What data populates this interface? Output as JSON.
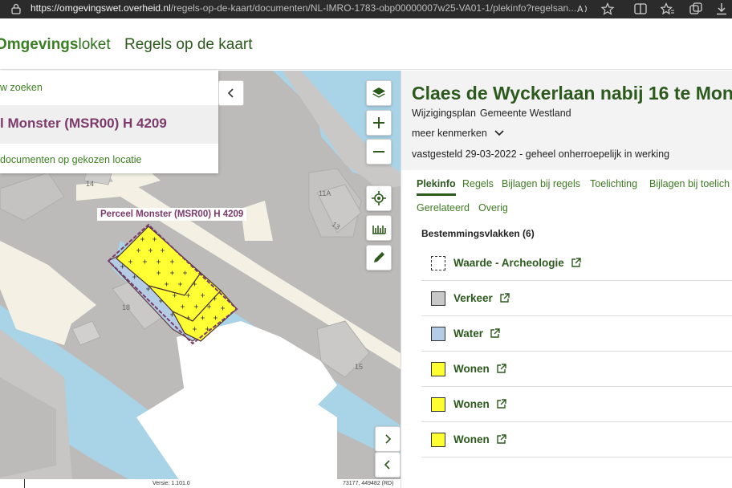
{
  "browser": {
    "url_host": "https://omgevingswet.overheid.nl",
    "url_path": "/regels-op-de-kaart/documenten/NL-IMRO-1783-obp00000007w25-VA01-1/plekinfo?regelsan..."
  },
  "header": {
    "brand_part1": "Omgevings",
    "brand_part2": "loket",
    "nav_title": "Regels op de kaart"
  },
  "search_panel": {
    "new_search": "w zoeken",
    "selected_location": "l Monster (MSR00) H 4209",
    "documents_link": "documenten op gekozen locatie"
  },
  "map": {
    "parcel_label": "Perceel Monster (MSR00) H 4209",
    "house_numbers": [
      "14",
      "11A",
      "13",
      "18",
      "15"
    ],
    "version": "Versie: 1.101.0",
    "coordinates": "73177, 449482 (RD)"
  },
  "document": {
    "title": "Claes de Wyckerlaan nabij 16 te Mon",
    "type": "Wijzigingsplan",
    "authority": "Gemeente Westland",
    "more_features": "meer kenmerken",
    "status": "vastgesteld 29-03-2022 - geheel onherroepelijk in werking"
  },
  "tabs": [
    {
      "label": "Plekinfo",
      "active": true
    },
    {
      "label": "Regels",
      "active": false
    },
    {
      "label": "Bijlagen bij regels",
      "active": false
    },
    {
      "label": "Toelichting",
      "active": false
    },
    {
      "label": "Bijlagen bij toelich",
      "active": false
    },
    {
      "label": "Gerelateerd",
      "active": false
    },
    {
      "label": "Overig",
      "active": false
    }
  ],
  "legend": {
    "title": "Bestemmingsvlakken (6)",
    "items": [
      {
        "label": "Waarde - Archeologie",
        "fill": "#ffffff",
        "dashed": true
      },
      {
        "label": "Verkeer",
        "fill": "#c8c8c8",
        "dashed": false
      },
      {
        "label": "Water",
        "fill": "#b5cde4",
        "dashed": false
      },
      {
        "label": "Wonen",
        "fill": "#ffff33",
        "dashed": false
      },
      {
        "label": "Wonen",
        "fill": "#ffff33",
        "dashed": false
      },
      {
        "label": "Wonen",
        "fill": "#ffff33",
        "dashed": false
      }
    ]
  },
  "colors": {
    "brand_green": "#2c5a1d",
    "link_green": "#3e8121",
    "parcel_purple": "#7c3a6b",
    "water": "#a9d3e6"
  }
}
